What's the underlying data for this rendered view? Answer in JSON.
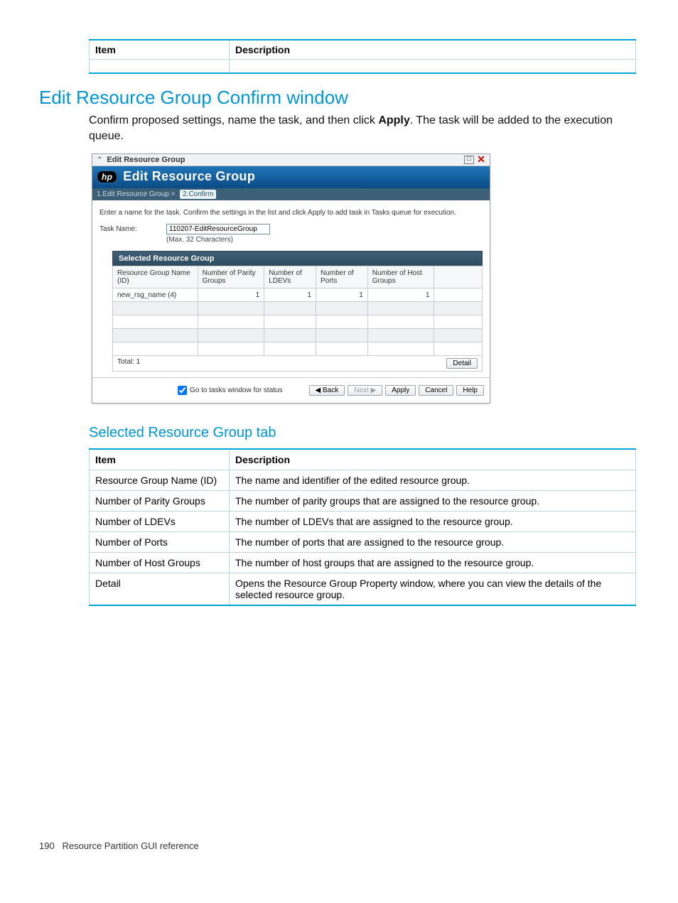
{
  "top_table": {
    "headers": [
      "Item",
      "Description"
    ]
  },
  "heading1": "Edit Resource Group Confirm window",
  "intro": {
    "pre": "Confirm proposed settings, name the task, and then click ",
    "bold": "Apply",
    "post": ". The task will be added to the execution queue."
  },
  "dialog": {
    "titlebar": {
      "title": "Edit Resource Group",
      "maximize_glyph": "□",
      "close_glyph": "✕"
    },
    "banner": "Edit Resource Group",
    "steps": {
      "step1": "1.Edit Resource Group",
      "sep": ">",
      "step2": "2.Confirm"
    },
    "hint": "Enter a name for the task. Confirm the settings in the list and click Apply to add task in Tasks queue for execution.",
    "task_name_label": "Task Name:",
    "task_name_value": "110207-EditResourceGroup",
    "task_name_under": "(Max. 32 Characters)",
    "srg": {
      "title": "Selected Resource Group",
      "columns": [
        "Resource Group Name (ID)",
        "Number of Parity Groups",
        "Number of LDEVs",
        "Number of Ports",
        "Number of Host Groups"
      ],
      "row": {
        "name": "new_rsg_name (4)",
        "parity": "1",
        "ldevs": "1",
        "ports": "1",
        "hostgroups": "1"
      },
      "total_label": "Total:  1",
      "detail_label": "Detail"
    },
    "buttons": {
      "go_tasks": "Go to tasks window for status",
      "back": "Back",
      "next": "Next",
      "apply": "Apply",
      "cancel": "Cancel",
      "help": "Help"
    }
  },
  "sub_heading": "Selected Resource Group tab",
  "desc_table": {
    "headers": [
      "Item",
      "Description"
    ],
    "rows": [
      [
        "Resource Group Name (ID)",
        "The name and identifier of the edited resource group."
      ],
      [
        "Number of Parity Groups",
        "The number of parity groups that are assigned to the resource group."
      ],
      [
        "Number of LDEVs",
        "The number of LDEVs that are assigned to the resource group."
      ],
      [
        "Number of Ports",
        "The number of ports that are assigned to the resource group."
      ],
      [
        "Number of Host Groups",
        "The number of host groups that are assigned to the resource group."
      ],
      [
        "Detail",
        "Opens the Resource Group Property window, where you can view the details of the selected resource group."
      ]
    ]
  },
  "footer": {
    "page": "190",
    "section": "Resource Partition GUI reference"
  }
}
